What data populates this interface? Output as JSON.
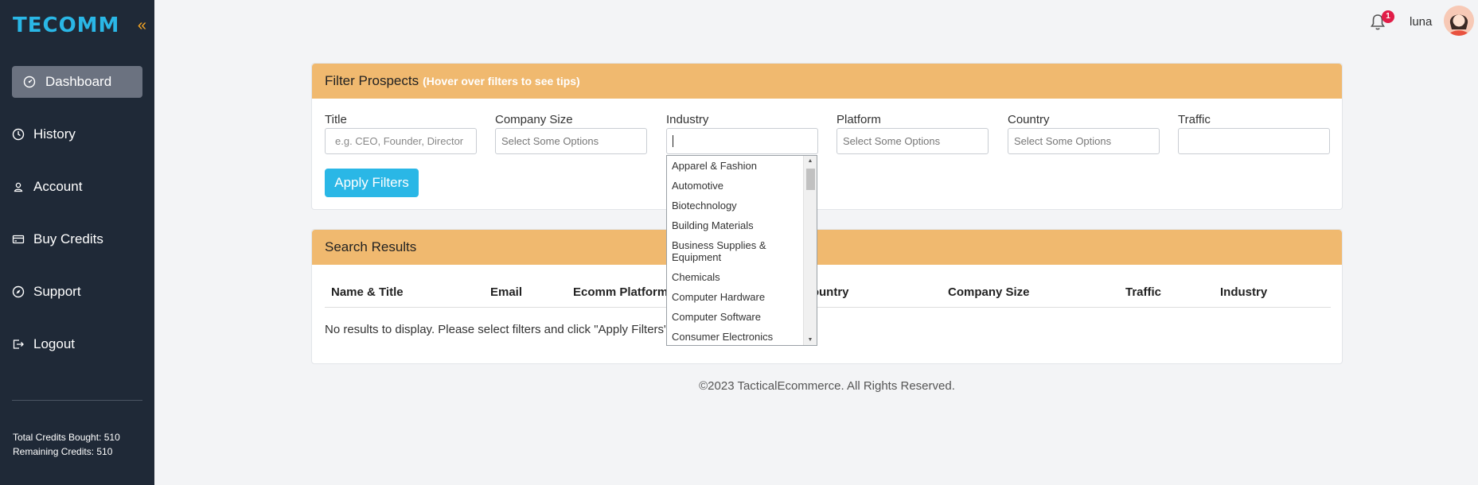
{
  "app": {
    "logo_text": "TECOMM",
    "collapse_icon": "double-chevron-left-icon",
    "accent_color": "#2ab7e6",
    "header_color": "#f0b96f"
  },
  "sidebar": {
    "items": [
      {
        "label": "Dashboard",
        "icon": "dashboard-gauge-icon",
        "active": true
      },
      {
        "label": "History",
        "icon": "clock-icon",
        "active": false
      },
      {
        "label": "Account",
        "icon": "user-icon",
        "active": false
      },
      {
        "label": "Buy Credits",
        "icon": "credit-card-icon",
        "active": false
      },
      {
        "label": "Support",
        "icon": "compass-icon",
        "active": false
      },
      {
        "label": "Logout",
        "icon": "logout-icon",
        "active": false
      }
    ],
    "total_credits": "Total Credits Bought: 510",
    "remaining_credits": "Remaining Credits: 510"
  },
  "header": {
    "notification_count": "1",
    "username": "luna"
  },
  "filter_card": {
    "title": "Filter Prospects",
    "tip": "(Hover over filters to see tips)",
    "fields": [
      {
        "label": "Title",
        "placeholder": "e.g. CEO, Founder, Director"
      },
      {
        "label": "Company Size",
        "placeholder": "Select Some Options"
      },
      {
        "label": "Industry",
        "placeholder": ""
      },
      {
        "label": "Platform",
        "placeholder": "Select Some Options"
      },
      {
        "label": "Country",
        "placeholder": "Select Some Options"
      },
      {
        "label": "Traffic",
        "placeholder": ""
      }
    ],
    "apply_label": "Apply Filters",
    "industry_options": [
      "Apparel & Fashion",
      "Automotive",
      "Biotechnology",
      "Building Materials",
      "Business Supplies & Equipment",
      "Chemicals",
      "Computer Hardware",
      "Computer Software",
      "Consumer Electronics"
    ]
  },
  "results_card": {
    "title": "Search Results",
    "columns": [
      "Name & Title",
      "Email",
      "Ecomm Platform",
      "Country",
      "Company Size",
      "Traffic",
      "Industry"
    ],
    "empty_message": "No results to display. Please select filters and click \"Apply Filters\"."
  },
  "footer": {
    "text": "©2023 TacticalEcommerce. All Rights Reserved."
  }
}
